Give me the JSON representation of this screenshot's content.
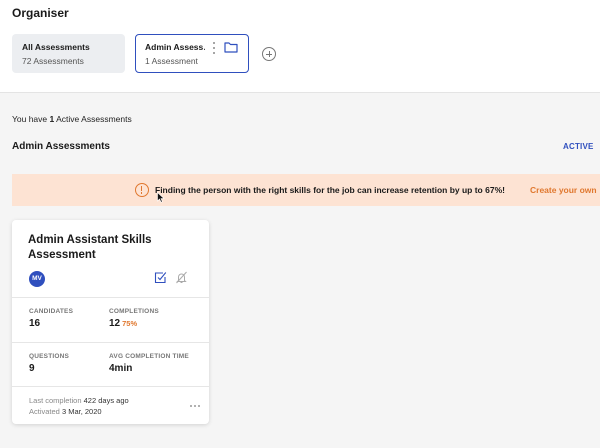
{
  "organiser": {
    "title": "Organiser",
    "folders": [
      {
        "name": "All Assessments",
        "count": "72 Assessments",
        "selected": false
      },
      {
        "name": "Admin Assess…",
        "count": "1 Assessment",
        "selected": true
      }
    ]
  },
  "summary": {
    "prefix": "You have ",
    "count": "1",
    "suffix": " Active Assessments"
  },
  "section": {
    "title": "Admin Assessments",
    "status": "ACTIVE"
  },
  "banner": {
    "text": "Finding the person with the right skills for the job can increase retention by up to 67%!",
    "link": "Create your own"
  },
  "card": {
    "title": "Admin Assistant Skills Assessment",
    "avatar_initials": "MV",
    "stats": {
      "candidates_label": "CANDIDATES",
      "candidates_value": "16",
      "completions_label": "COMPLETIONS",
      "completions_value": "12",
      "completions_pct": "75%",
      "questions_label": "QUESTIONS",
      "questions_value": "9",
      "avg_label": "AVG COMPLETION TIME",
      "avg_value": "4min"
    },
    "last_completion_label": "Last completion",
    "last_completion_value": "422 days ago",
    "activated_label": "Activated",
    "activated_value": "3 Mar, 2020"
  },
  "colors": {
    "accent": "#2f4fbe",
    "warning": "#e0782f",
    "banner_bg": "#fde3d3",
    "page_bg": "#f5f5f5"
  },
  "icons": [
    "kebab-menu-icon",
    "folder-icon",
    "add-folder-icon",
    "warning-icon",
    "mouse-cursor-icon",
    "edit-check-icon",
    "bell-off-icon",
    "more-horizontal-icon"
  ]
}
